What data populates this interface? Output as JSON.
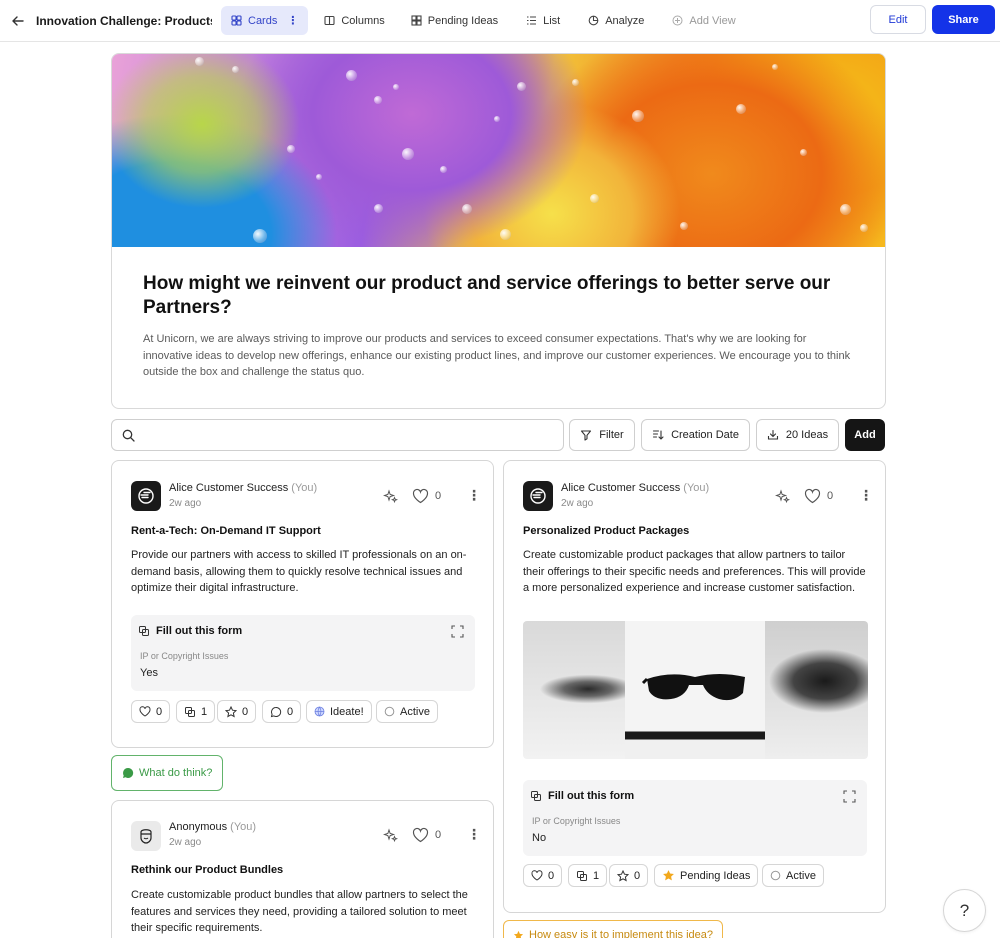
{
  "header": {
    "title": "Innovation Challenge: Products...",
    "views": [
      {
        "label": "Cards",
        "active": true
      },
      {
        "label": "Columns"
      },
      {
        "label": "Pending Ideas"
      },
      {
        "label": "List"
      },
      {
        "label": "Analyze"
      },
      {
        "label": "Add View"
      }
    ],
    "edit_label": "Edit",
    "share_label": "Share"
  },
  "challenge": {
    "heading": "How might we reinvent our product and service offerings to better serve our Partners?",
    "description": "At Unicorn, we are always striving to improve our products and services to exceed consumer expectations. That's why we are looking for innovative ideas to develop new offerings, enhance our existing product lines, and improve our customer experiences. We encourage you to think outside the box and challenge the status quo."
  },
  "toolbar": {
    "search_placeholder": "",
    "filter_label": "Filter",
    "sort_label": "Creation Date",
    "count_label": "20 Ideas",
    "add_label": "Add"
  },
  "ideas": [
    {
      "author": "Alice Customer Success",
      "you": "(You)",
      "time": "2w ago",
      "likes": "0",
      "title": "Rent-a-Tech: On-Demand IT Support",
      "description": "Provide our partners with access to skilled IT professionals on an on-demand basis, allowing them to quickly resolve technical issues and optimize their digital infrastructure.",
      "form_title": "Fill out this form",
      "form_label": "IP or Copyright Issues",
      "form_value": "Yes",
      "chips": {
        "likes": "0",
        "forms": "1",
        "stars": "0",
        "comments": "0",
        "stage": "Ideate!",
        "status": "Active"
      },
      "cta": "What do think?"
    },
    {
      "author": "Alice Customer Success",
      "you": "(You)",
      "time": "2w ago",
      "likes": "0",
      "title": "Personalized Product Packages",
      "description": "Create customizable product packages that allow partners to tailor their offerings to their specific needs and preferences. This will provide a more personalized experience and increase customer satisfaction.",
      "form_title": "Fill out this form",
      "form_label": "IP or Copyright Issues",
      "form_value": "No",
      "chips": {
        "likes": "0",
        "forms": "1",
        "stars": "0",
        "stage": "Pending Ideas",
        "status": "Active"
      },
      "cta": "How easy is it to implement this idea?"
    },
    {
      "author": "Anonymous",
      "you": "(You)",
      "time": "2w ago",
      "likes": "0",
      "title": "Rethink our Product Bundles",
      "description": "Create customizable product bundles that allow partners to select the features and services they need, providing a tailored solution to meet their specific requirements."
    }
  ],
  "help_label": "?",
  "colors": {
    "accent": "#1433e8",
    "active_view_bg": "#e6e9fb",
    "comment_green": "#3a9a46",
    "ease_orange": "#c78a10"
  }
}
